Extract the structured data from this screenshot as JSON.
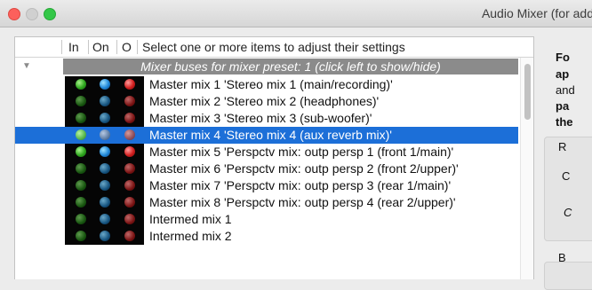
{
  "window": {
    "title": "Audio Mixer (for add"
  },
  "table": {
    "columns": {
      "in": "In",
      "on": "On",
      "o": "O",
      "desc": "Select one or more items to adjust their settings"
    },
    "group_label": "Mixer buses for mixer preset: 1 (click left to show/hide)",
    "rows": [
      {
        "label": "Master mix 1 'Stereo mix 1 (main/recording)'",
        "dim": false
      },
      {
        "label": "Master mix 2 'Stereo mix 2 (headphones)'",
        "dim": true
      },
      {
        "label": "Master mix 3 'Stereo mix 3 (sub-woofer)'",
        "dim": true
      },
      {
        "label": "Master mix 4 'Stereo mix 4 (aux reverb mix)'",
        "dim": false
      },
      {
        "label": "Master mix 5 'Perspctv mix: outp persp 1 (front 1/main)'",
        "dim": false
      },
      {
        "label": "Master mix 6 'Perspctv mix: outp persp 2 (front 2/upper)'",
        "dim": true
      },
      {
        "label": "Master mix 7 'Perspctv mix: outp persp 3 (rear 1/main)'",
        "dim": true
      },
      {
        "label": "Master mix 8 'Perspctv mix: outp persp 4 (rear 2/upper)'",
        "dim": true
      },
      {
        "label": "Intermed mix 1",
        "dim": true
      },
      {
        "label": "Intermed mix 2",
        "dim": true
      }
    ],
    "selected_index": 3
  },
  "side": {
    "l1": "Fo",
    "l2": "ap",
    "l3": "and",
    "l4": "pa",
    "l5": "the",
    "r1": "R",
    "c1": "C",
    "c2": "C",
    "b1": "B"
  },
  "colors": {
    "selection": "#1c6fd8",
    "group_bg": "#8b8b8b"
  }
}
